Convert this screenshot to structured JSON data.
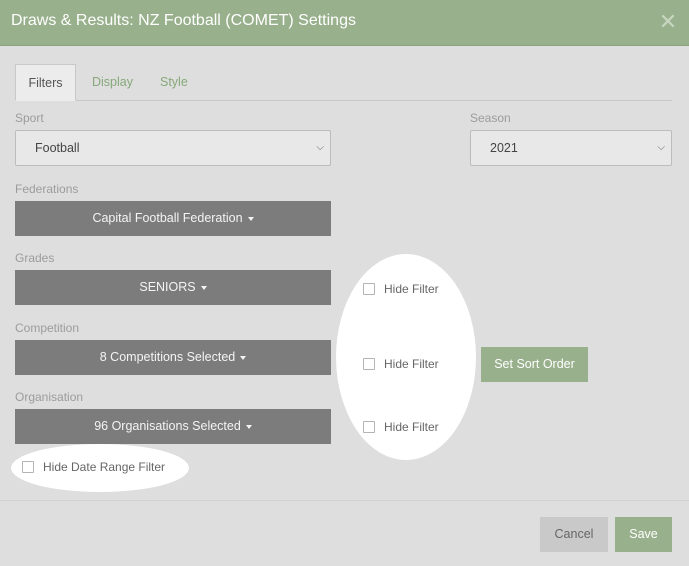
{
  "dialog": {
    "title": "Draws & Results: NZ Football (COMET) Settings",
    "close_glyph": "✕"
  },
  "tabs": [
    {
      "label": "Filters",
      "active": true
    },
    {
      "label": "Display",
      "active": false
    },
    {
      "label": "Style",
      "active": false
    }
  ],
  "sport": {
    "label": "Sport",
    "value": "Football"
  },
  "season": {
    "label": "Season",
    "value": "2021"
  },
  "federations": {
    "label": "Federations",
    "button": "Capital Football Federation"
  },
  "grades": {
    "label": "Grades",
    "button": "SENIORS",
    "hide_filter": "Hide Filter"
  },
  "competition": {
    "label": "Competition",
    "button": "8 Competitions Selected",
    "hide_filter": "Hide Filter",
    "sort_button": "Set Sort Order"
  },
  "organisation": {
    "label": "Organisation",
    "button": "96 Organisations Selected",
    "hide_filter": "Hide Filter"
  },
  "date_range": {
    "label": "Hide Date Range Filter"
  },
  "footer": {
    "cancel": "Cancel",
    "save": "Save"
  },
  "colors": {
    "header": "#98b08c",
    "accent": "#98b08c",
    "dropdown": "#7c7c7c"
  }
}
